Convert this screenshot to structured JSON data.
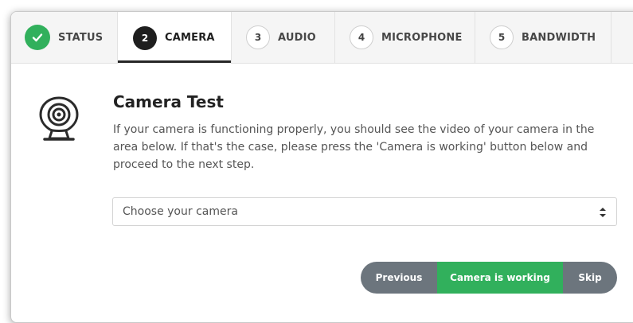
{
  "tabs": [
    {
      "badge": "",
      "label": "STATUS",
      "state": "done",
      "icon": "check-icon"
    },
    {
      "badge": "2",
      "label": "CAMERA",
      "state": "active"
    },
    {
      "badge": "3",
      "label": "AUDIO",
      "state": "pending"
    },
    {
      "badge": "4",
      "label": "MICROPHONE",
      "state": "pending"
    },
    {
      "badge": "5",
      "label": "BANDWIDTH",
      "state": "pending"
    }
  ],
  "main": {
    "icon": "webcam-icon",
    "title": "Camera Test",
    "description": "If your camera is functioning properly, you should see the video of your camera in the area below. If that's the case, please press the 'Camera is working' button below and proceed to the next step.",
    "camera_select": {
      "value": "Choose your camera"
    }
  },
  "buttons": {
    "previous": "Previous",
    "working": "Camera is working",
    "skip": "Skip"
  },
  "colors": {
    "success": "#31b05c",
    "secondary": "#6c757d",
    "active_badge": "#1e1e1e"
  }
}
